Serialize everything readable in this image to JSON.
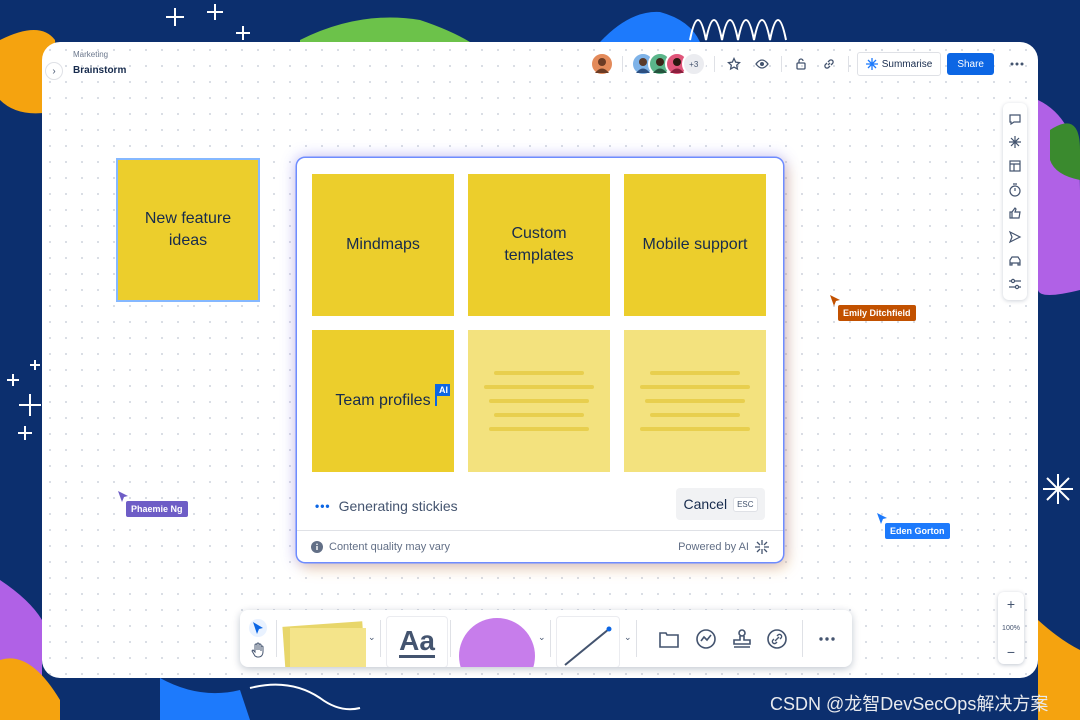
{
  "breadcrumb": {
    "parent": "Marketing",
    "title": "Brainstorm"
  },
  "header": {
    "avatar_overflow": "+3",
    "summarise_label": "Summarise",
    "share_label": "Share",
    "icons": [
      "star-icon",
      "eye-icon",
      "lock-icon",
      "link-icon",
      "more-icon"
    ]
  },
  "side_toolbar": [
    "comment-icon",
    "ai-spark-icon",
    "template-icon",
    "timer-icon",
    "thumbs-up-icon",
    "send-icon",
    "vehicle-icon",
    "sliders-icon"
  ],
  "board": {
    "standalone_sticky": "New feature ideas"
  },
  "ai_modal": {
    "stickies": [
      "Mindmaps",
      "Custom templates",
      "Mobile support",
      "Team profiles"
    ],
    "ai_label": "AI",
    "status": "Generating stickies",
    "cancel_label": "Cancel",
    "cancel_shortcut": "ESC",
    "footer_note": "Content quality may vary",
    "footer_powered": "Powered by AI"
  },
  "cursors": [
    {
      "name": "Emily Ditchfield",
      "color": "#c25100"
    },
    {
      "name": "Phaemie Ng",
      "color": "#6e5dc6"
    },
    {
      "name": "Eden Gorton",
      "color": "#1d7afc"
    }
  ],
  "bottom_toolbar": {
    "text_tool_label": "Aa",
    "icons": [
      "select-icon",
      "hand-icon",
      "sticky-icon",
      "text-icon",
      "shape-icon",
      "line-icon",
      "frame-icon",
      "smart-icon",
      "stamp-icon",
      "link-icon",
      "more-icon"
    ]
  },
  "zoom": {
    "plus": "+",
    "level": "100%",
    "minus": "−"
  },
  "watermark": "CSDN @龙智DevSecOps解决方案",
  "colors": {
    "accent": "#0c66e4",
    "sticky": "#ecce2c",
    "sticky_light": "#f3e27e",
    "background": "#0c2f6e"
  }
}
